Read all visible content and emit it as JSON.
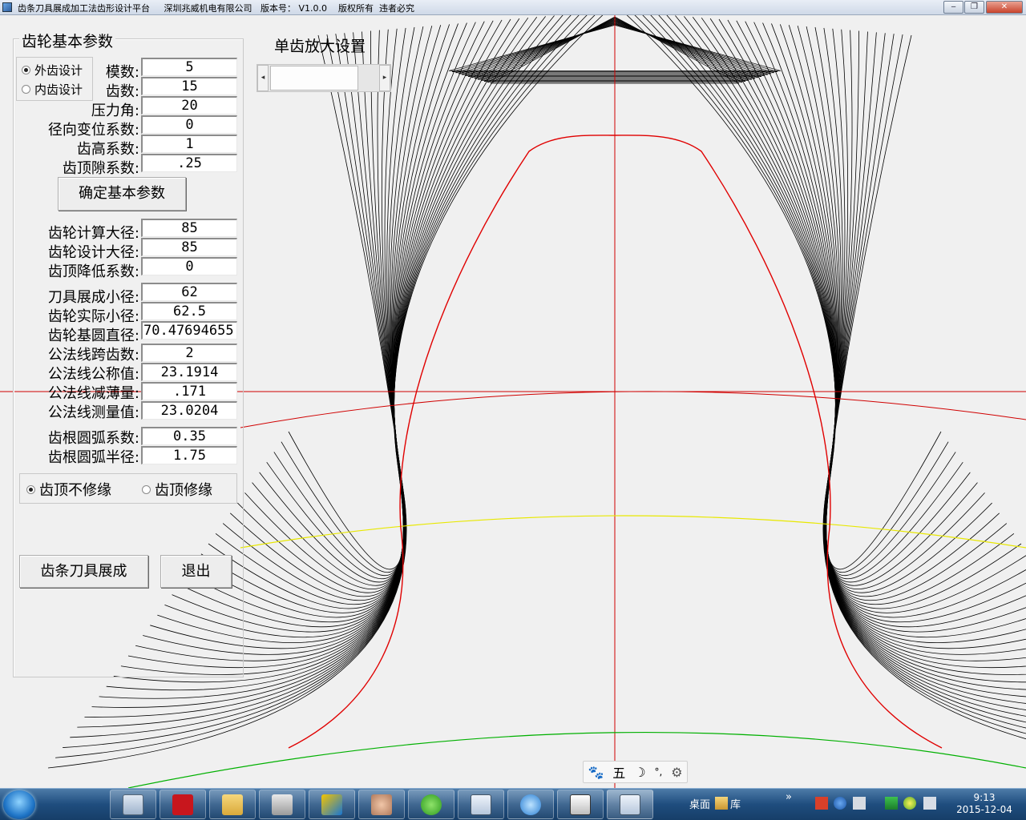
{
  "window": {
    "title": "齿条刀具展成加工法齿形设计平台     深圳兆威机电有限公司   版本号： V1.0.0    版权所有  违者必究",
    "minimize_glyph": "‒",
    "maximize_glyph": "❐",
    "close_glyph": "✕"
  },
  "panel": {
    "title": "齿轮基本参数",
    "design_options": [
      {
        "label": "外齿设计",
        "selected": true
      },
      {
        "label": "内齿设计",
        "selected": false
      }
    ],
    "fields": {
      "modulus": {
        "label": "模数:",
        "value": "5"
      },
      "teeth": {
        "label": "齿数:",
        "value": "15"
      },
      "pressure_angle": {
        "label": "压力角:",
        "value": "20"
      },
      "radial_shift": {
        "label": "径向变位系数:",
        "value": "0"
      },
      "addendum_coef": {
        "label": "齿高系数:",
        "value": "1"
      },
      "clearance_coef": {
        "label": "齿顶隙系数:",
        "value": ".25"
      },
      "calc_outer_dia": {
        "label": "齿轮计算大径:",
        "value": "85"
      },
      "design_outer_dia": {
        "label": "齿轮设计大径:",
        "value": "85"
      },
      "tip_reduction": {
        "label": "齿顶降低系数:",
        "value": "0"
      },
      "tool_root_dia": {
        "label": "刀具展成小径:",
        "value": "62"
      },
      "actual_root_dia": {
        "label": "齿轮实际小径:",
        "value": "62.5"
      },
      "base_circle_dia": {
        "label": "齿轮基圆直径:",
        "value": "70.47694655"
      },
      "span_teeth": {
        "label": "公法线跨齿数:",
        "value": "2"
      },
      "span_nominal": {
        "label": "公法线公称值:",
        "value": "23.1914"
      },
      "span_thinning": {
        "label": "公法线减薄量:",
        "value": ".171"
      },
      "span_measured": {
        "label": "公法线测量值:",
        "value": "23.0204"
      },
      "root_fillet_coef": {
        "label": "齿根圆弧系数:",
        "value": "0.35"
      },
      "root_fillet_radius": {
        "label": "齿根圆弧半径:",
        "value": "1.75"
      }
    },
    "confirm_button": "确定基本参数",
    "tip_options": [
      {
        "label": "齿顶不修缘",
        "selected": true
      },
      {
        "label": "齿顶修缘",
        "selected": false
      }
    ],
    "generate_button": "齿条刀具展成",
    "exit_button": "退出"
  },
  "zoom": {
    "label": "单齿放大设置",
    "left_arrow": "◂",
    "right_arrow": "▸"
  },
  "colors": {
    "profile_red": "#e00000",
    "envelope_black": "#000000",
    "pitch_circle_red": "#d00000",
    "base_circle_yellow": "#e8e800",
    "root_circle_green": "#00b000",
    "axis_red": "#d00000"
  },
  "ime_bar": {
    "items": [
      "🐾",
      "五",
      "☽",
      "°,",
      "⚙"
    ]
  },
  "taskbar": {
    "desktop_label": "桌面",
    "library_label": "库",
    "chevron": "»",
    "clock_time": "9:13",
    "clock_date": "2015-12-04"
  }
}
